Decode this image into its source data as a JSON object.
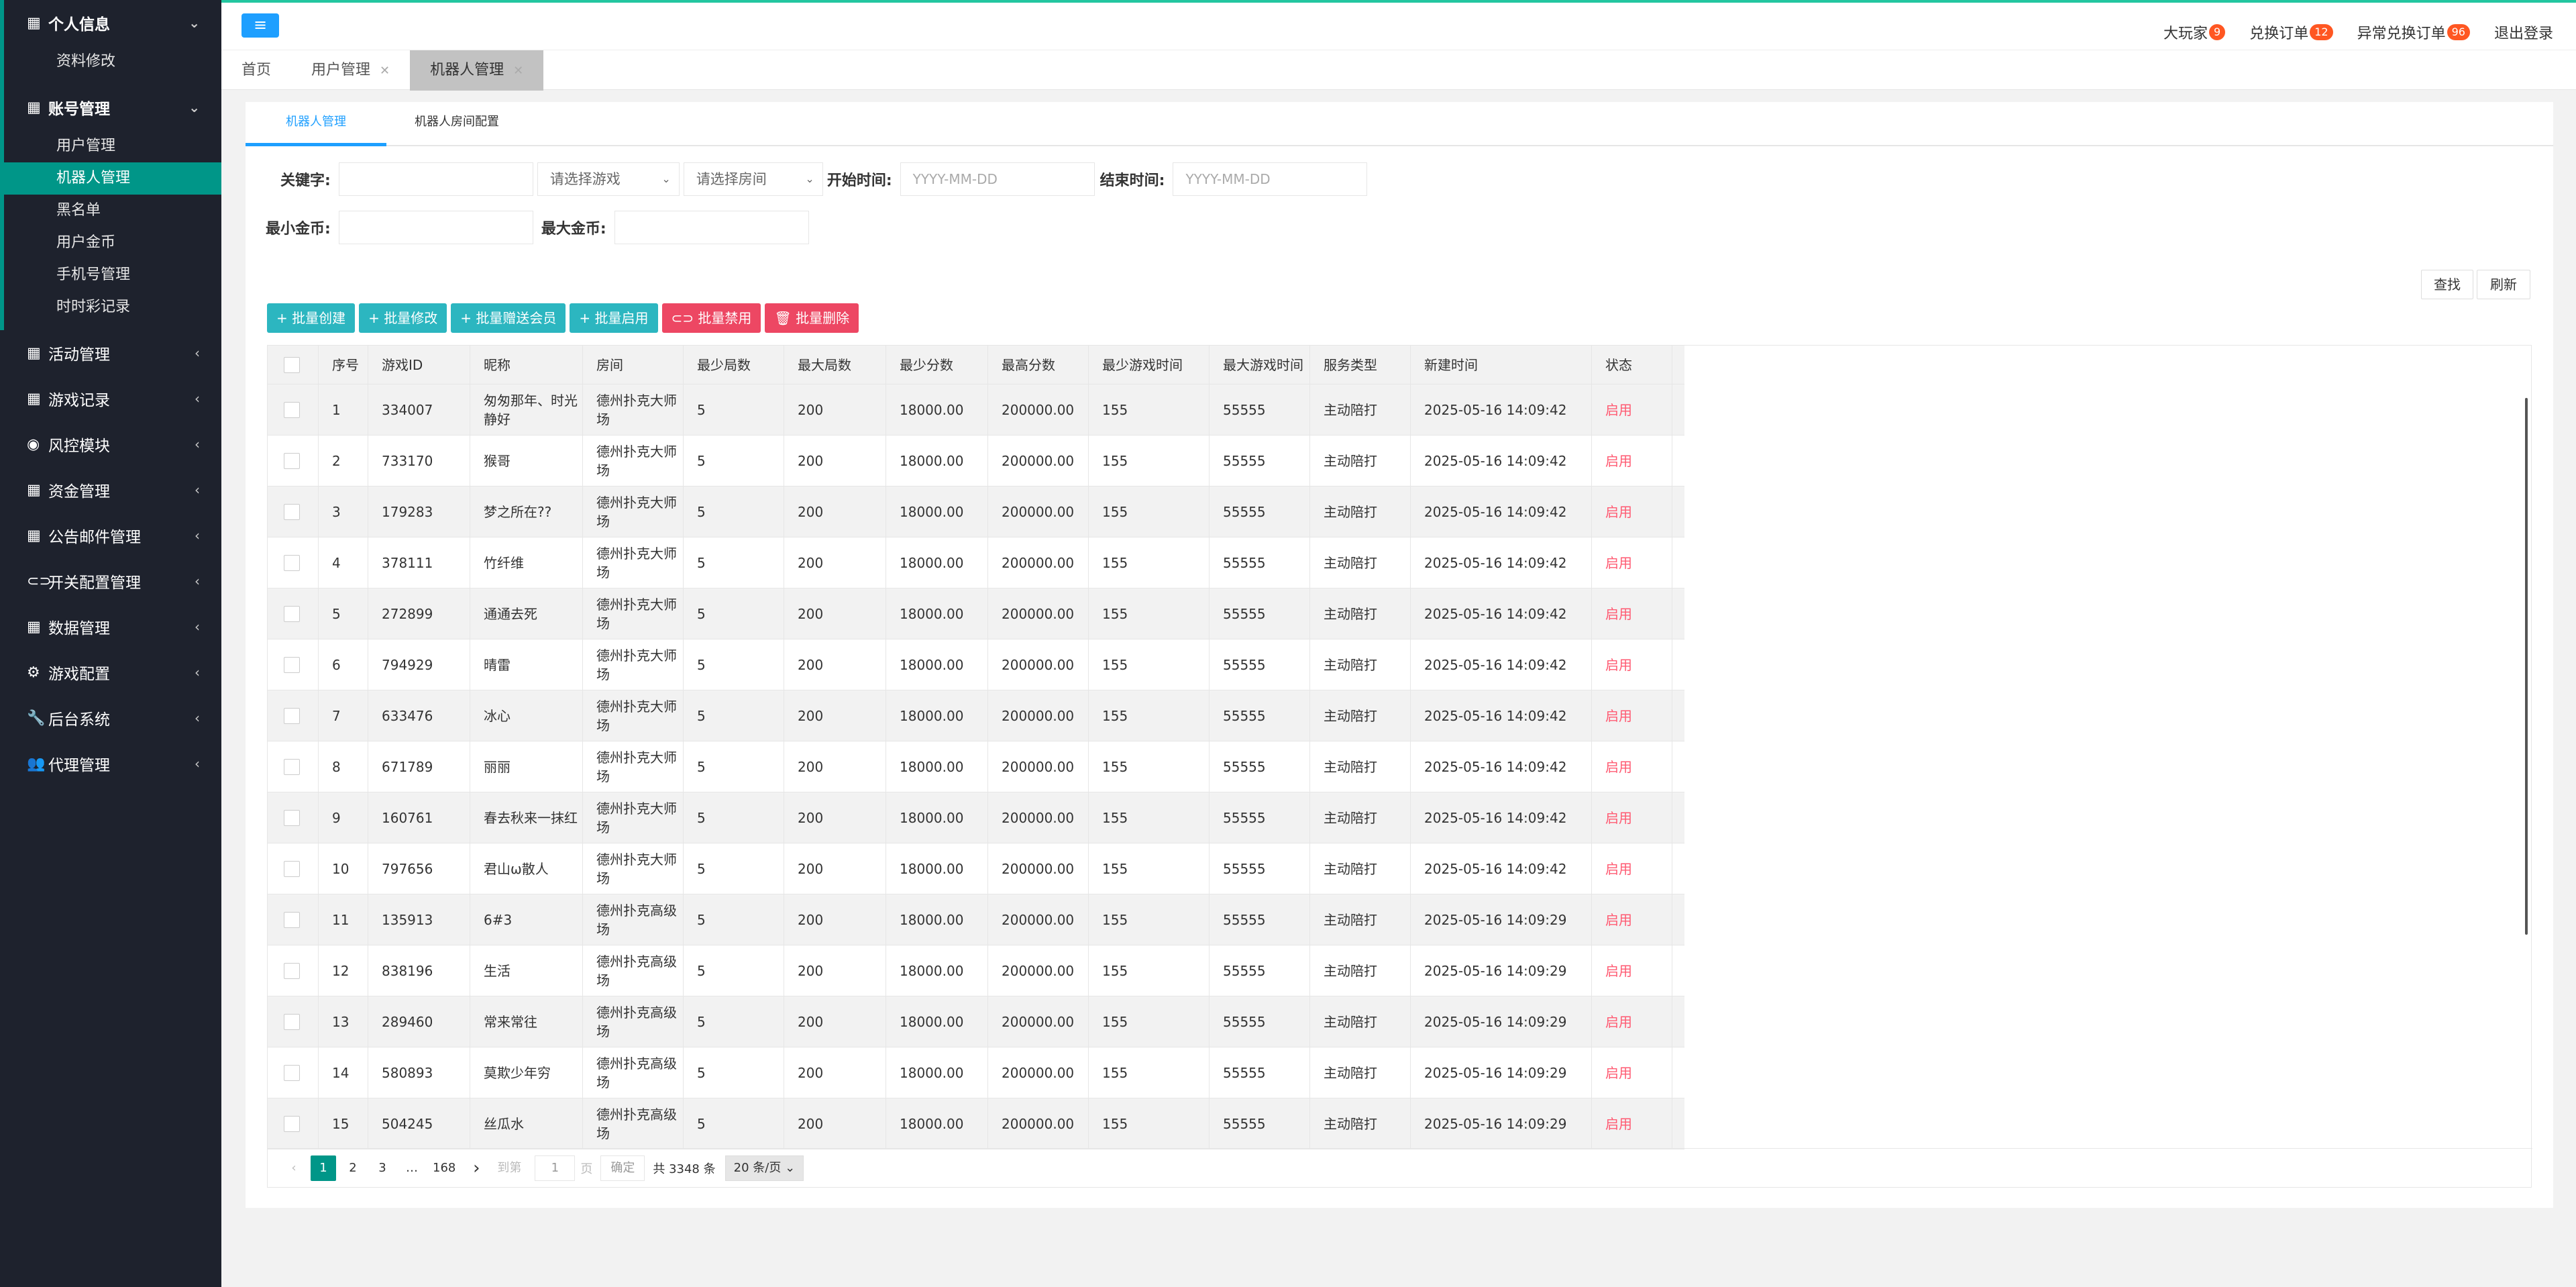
{
  "sidebar": {
    "groups": [
      {
        "label": "个人信息",
        "icon": "grid-icon",
        "open": true,
        "items": [
          {
            "label": "资料修改",
            "active": false
          }
        ]
      },
      {
        "label": "账号管理",
        "icon": "grid-icon",
        "open": true,
        "items": [
          {
            "label": "用户管理",
            "active": false
          },
          {
            "label": "机器人管理",
            "active": true
          },
          {
            "label": "黑名单",
            "active": false
          },
          {
            "label": "用户金币",
            "active": false
          },
          {
            "label": "手机号管理",
            "active": false
          },
          {
            "label": "时时彩记录",
            "active": false
          }
        ]
      },
      {
        "label": "活动管理",
        "icon": "grid-icon",
        "open": false,
        "items": []
      },
      {
        "label": "游戏记录",
        "icon": "grid-icon",
        "open": false,
        "items": []
      },
      {
        "label": "风控模块",
        "icon": "eye-icon",
        "open": false,
        "items": []
      },
      {
        "label": "资金管理",
        "icon": "grid-icon",
        "open": false,
        "items": []
      },
      {
        "label": "公告邮件管理",
        "icon": "grid-icon",
        "open": false,
        "items": []
      },
      {
        "label": "开关配置管理",
        "icon": "toggle-icon",
        "open": false,
        "items": []
      },
      {
        "label": "数据管理",
        "icon": "grid-icon",
        "open": false,
        "items": []
      },
      {
        "label": "游戏配置",
        "icon": "gears-icon",
        "open": false,
        "items": []
      },
      {
        "label": "后台系统",
        "icon": "wrench-icon",
        "open": false,
        "items": []
      },
      {
        "label": "代理管理",
        "icon": "users-icon",
        "open": false,
        "items": []
      }
    ]
  },
  "header": {
    "links": [
      {
        "label": "大玩家",
        "badge": "9"
      },
      {
        "label": "兑换订单",
        "badge": "12"
      },
      {
        "label": "异常兑换订单",
        "badge": "96"
      },
      {
        "label": "退出登录",
        "badge": ""
      }
    ]
  },
  "pagetabs": [
    {
      "label": "首页",
      "closable": false,
      "active": false
    },
    {
      "label": "用户管理",
      "closable": true,
      "active": false
    },
    {
      "label": "机器人管理",
      "closable": true,
      "active": true
    }
  ],
  "subtabs": [
    {
      "label": "机器人管理",
      "active": true
    },
    {
      "label": "机器人房间配置",
      "active": false
    }
  ],
  "search": {
    "keyword_label": "关键字:",
    "keyword_value": "",
    "game_placeholder": "请选择游戏",
    "room_placeholder": "请选择房间",
    "start_label": "开始时间:",
    "start_placeholder": "YYYY-MM-DD",
    "end_label": "结束时间:",
    "end_placeholder": "YYYY-MM-DD",
    "min_gold_label": "最小金币:",
    "max_gold_label": "最大金币:",
    "find_label": "查找",
    "refresh_label": "刷新"
  },
  "batch": [
    {
      "label": "批量创建",
      "icon": "+",
      "color": "teal"
    },
    {
      "label": "批量修改",
      "icon": "+",
      "color": "teal"
    },
    {
      "label": "批量赠送会员",
      "icon": "+",
      "color": "teal"
    },
    {
      "label": "批量启用",
      "icon": "+",
      "color": "teal"
    },
    {
      "label": "批量禁用",
      "icon": "⊂⊃",
      "color": "red"
    },
    {
      "label": "批量删除",
      "icon": "🗑",
      "color": "red"
    }
  ],
  "table": {
    "columns": [
      "",
      "序号",
      "游戏ID",
      "昵称",
      "房间",
      "最少局数",
      "最大局数",
      "最少分数",
      "最高分数",
      "最少游戏时间",
      "最大游戏时间",
      "服务类型",
      "新建时间",
      "状态"
    ],
    "rows": [
      [
        "1",
        "334007",
        "匆匆那年、时光静好",
        "德州扑克大师场",
        "5",
        "200",
        "18000.00",
        "200000.00",
        "155",
        "55555",
        "主动陪打",
        "2025-05-16 14:09:42",
        "启用"
      ],
      [
        "2",
        "733170",
        "猴哥",
        "德州扑克大师场",
        "5",
        "200",
        "18000.00",
        "200000.00",
        "155",
        "55555",
        "主动陪打",
        "2025-05-16 14:09:42",
        "启用"
      ],
      [
        "3",
        "179283",
        "梦之所在??",
        "德州扑克大师场",
        "5",
        "200",
        "18000.00",
        "200000.00",
        "155",
        "55555",
        "主动陪打",
        "2025-05-16 14:09:42",
        "启用"
      ],
      [
        "4",
        "378111",
        "竹纤维",
        "德州扑克大师场",
        "5",
        "200",
        "18000.00",
        "200000.00",
        "155",
        "55555",
        "主动陪打",
        "2025-05-16 14:09:42",
        "启用"
      ],
      [
        "5",
        "272899",
        "通通去死",
        "德州扑克大师场",
        "5",
        "200",
        "18000.00",
        "200000.00",
        "155",
        "55555",
        "主动陪打",
        "2025-05-16 14:09:42",
        "启用"
      ],
      [
        "6",
        "794929",
        "晴雷",
        "德州扑克大师场",
        "5",
        "200",
        "18000.00",
        "200000.00",
        "155",
        "55555",
        "主动陪打",
        "2025-05-16 14:09:42",
        "启用"
      ],
      [
        "7",
        "633476",
        "冰心",
        "德州扑克大师场",
        "5",
        "200",
        "18000.00",
        "200000.00",
        "155",
        "55555",
        "主动陪打",
        "2025-05-16 14:09:42",
        "启用"
      ],
      [
        "8",
        "671789",
        "丽丽",
        "德州扑克大师场",
        "5",
        "200",
        "18000.00",
        "200000.00",
        "155",
        "55555",
        "主动陪打",
        "2025-05-16 14:09:42",
        "启用"
      ],
      [
        "9",
        "160761",
        "春去秋来一抹红",
        "德州扑克大师场",
        "5",
        "200",
        "18000.00",
        "200000.00",
        "155",
        "55555",
        "主动陪打",
        "2025-05-16 14:09:42",
        "启用"
      ],
      [
        "10",
        "797656",
        "君山ω散人",
        "德州扑克大师场",
        "5",
        "200",
        "18000.00",
        "200000.00",
        "155",
        "55555",
        "主动陪打",
        "2025-05-16 14:09:42",
        "启用"
      ],
      [
        "11",
        "135913",
        "6#3",
        "德州扑克高级场",
        "5",
        "200",
        "18000.00",
        "200000.00",
        "155",
        "55555",
        "主动陪打",
        "2025-05-16 14:09:29",
        "启用"
      ],
      [
        "12",
        "838196",
        "生活",
        "德州扑克高级场",
        "5",
        "200",
        "18000.00",
        "200000.00",
        "155",
        "55555",
        "主动陪打",
        "2025-05-16 14:09:29",
        "启用"
      ],
      [
        "13",
        "289460",
        "常来常往",
        "德州扑克高级场",
        "5",
        "200",
        "18000.00",
        "200000.00",
        "155",
        "55555",
        "主动陪打",
        "2025-05-16 14:09:29",
        "启用"
      ],
      [
        "14",
        "580893",
        "莫欺少年穷",
        "德州扑克高级场",
        "5",
        "200",
        "18000.00",
        "200000.00",
        "155",
        "55555",
        "主动陪打",
        "2025-05-16 14:09:29",
        "启用"
      ],
      [
        "15",
        "504245",
        "丝瓜水",
        "德州扑克高级场",
        "5",
        "200",
        "18000.00",
        "200000.00",
        "155",
        "55555",
        "主动陪打",
        "2025-05-16 14:09:29",
        "启用"
      ]
    ]
  },
  "pager": {
    "prev": "‹",
    "pages": [
      "1",
      "2",
      "3"
    ],
    "current": "1",
    "ellipsis": "…",
    "last": "168",
    "next": "›",
    "goto_label": "到第",
    "goto_value": "1",
    "page_unit": "页",
    "confirm_label": "确定",
    "total_label": "共 3348 条",
    "page_size": "20 条/页"
  },
  "colors": {
    "accent": "#009688",
    "sidebar_bg": "#1e222d",
    "blue": "#1e9fff",
    "danger": "#ed4763",
    "status": "#ff5a72"
  }
}
